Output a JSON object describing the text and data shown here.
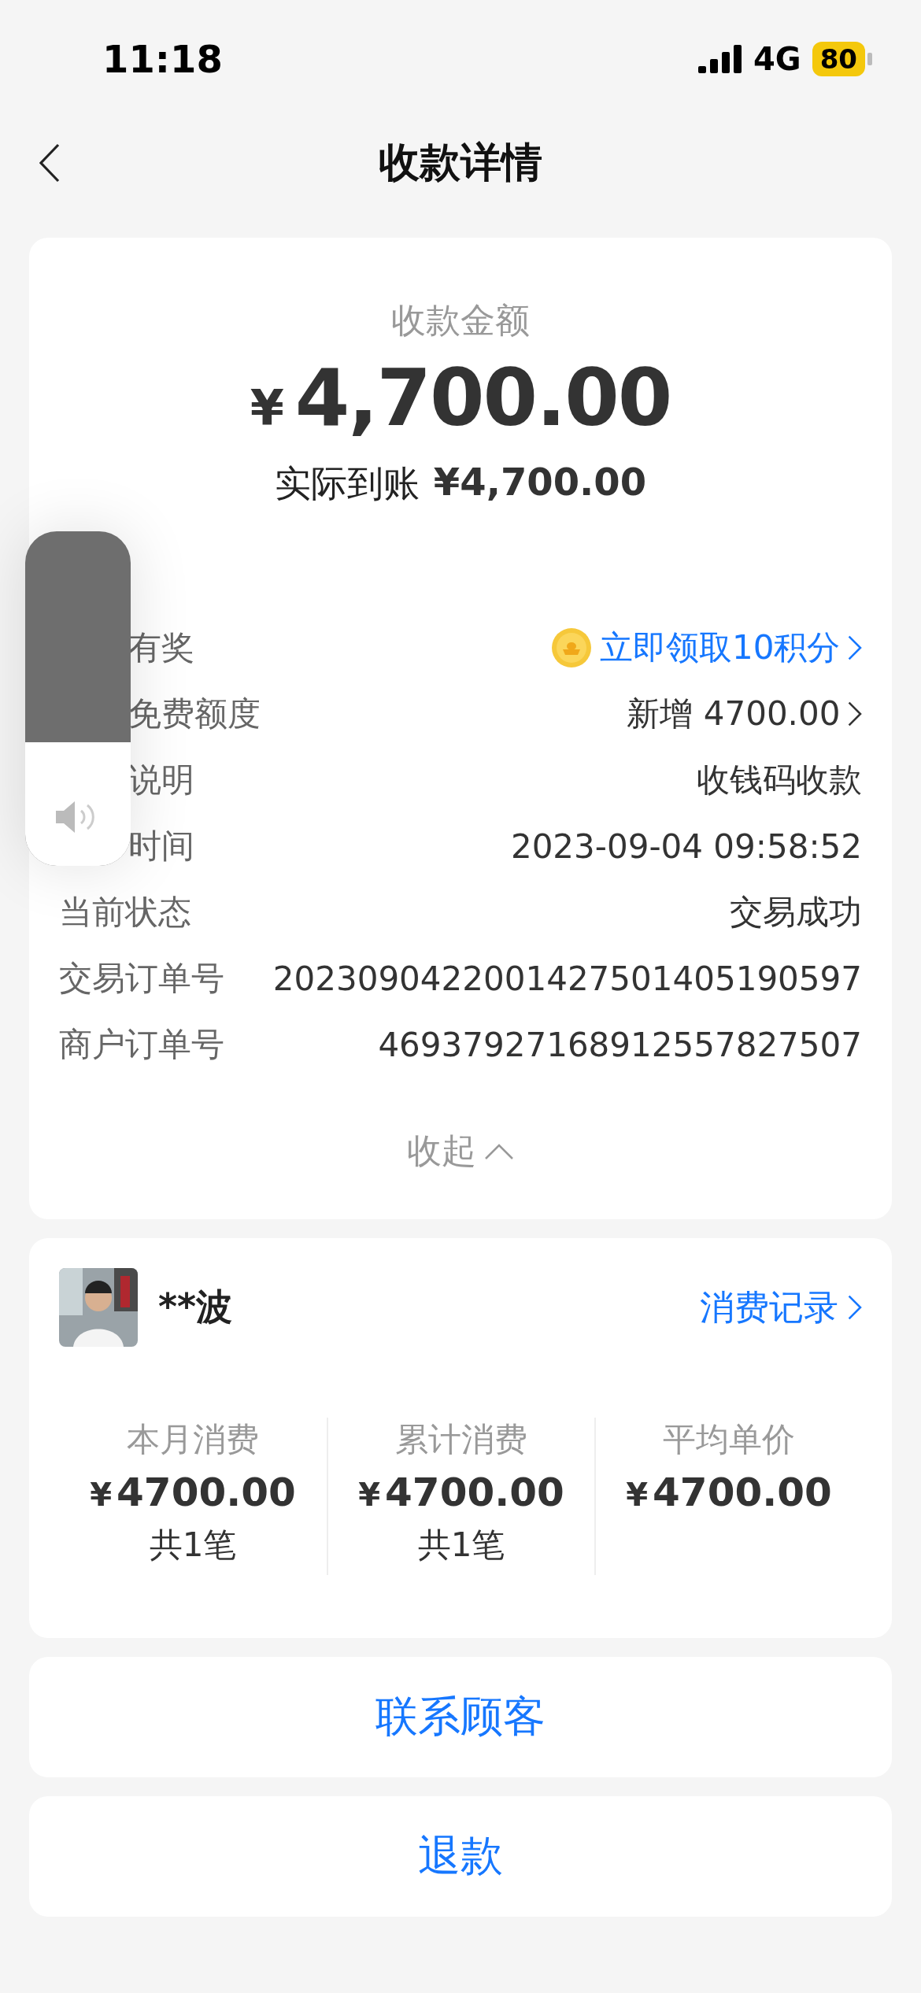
{
  "status_bar": {
    "time": "11:18",
    "network": "4G",
    "battery": "80"
  },
  "header": {
    "title": "收款详情"
  },
  "summary": {
    "label": "收款金额",
    "currency": "¥",
    "amount": "4,700.00",
    "received_label": "实际到账",
    "received": "¥4,700.00"
  },
  "details": [
    {
      "label": "有奖",
      "covered": true,
      "value": "立即领取10积分",
      "kind": "reward",
      "link": true
    },
    {
      "label": "免费额度",
      "covered": true,
      "value": "新增 4700.00",
      "kind": "plain",
      "link": true
    },
    {
      "label": "说明",
      "covered": true,
      "value": "收钱码收款",
      "kind": "plain",
      "link": false
    },
    {
      "label": "时间",
      "covered": true,
      "value": "2023-09-04 09:58:52",
      "kind": "plain",
      "link": false
    },
    {
      "label": "当前状态",
      "covered": false,
      "value": "交易成功",
      "kind": "plain",
      "link": false
    },
    {
      "label": "交易订单号",
      "covered": false,
      "value": "2023090422001427501405190597",
      "kind": "plain",
      "link": false
    },
    {
      "label": "商户订单号",
      "covered": false,
      "value": "46937927168912557827507",
      "kind": "plain",
      "link": false
    }
  ],
  "collapse": {
    "label": "收起",
    "expanded": true
  },
  "customer": {
    "name": "**波",
    "records_link": "消费记录",
    "stats": [
      {
        "label": "本月消费",
        "currency": "¥",
        "value": "4700.00",
        "count": "共1笔"
      },
      {
        "label": "累计消费",
        "currency": "¥",
        "value": "4700.00",
        "count": "共1笔"
      },
      {
        "label": "平均单价",
        "currency": "¥",
        "value": "4700.00"
      }
    ]
  },
  "actions": [
    "联系顾客",
    "退款"
  ],
  "volume_hud": {
    "level": 0.37
  }
}
